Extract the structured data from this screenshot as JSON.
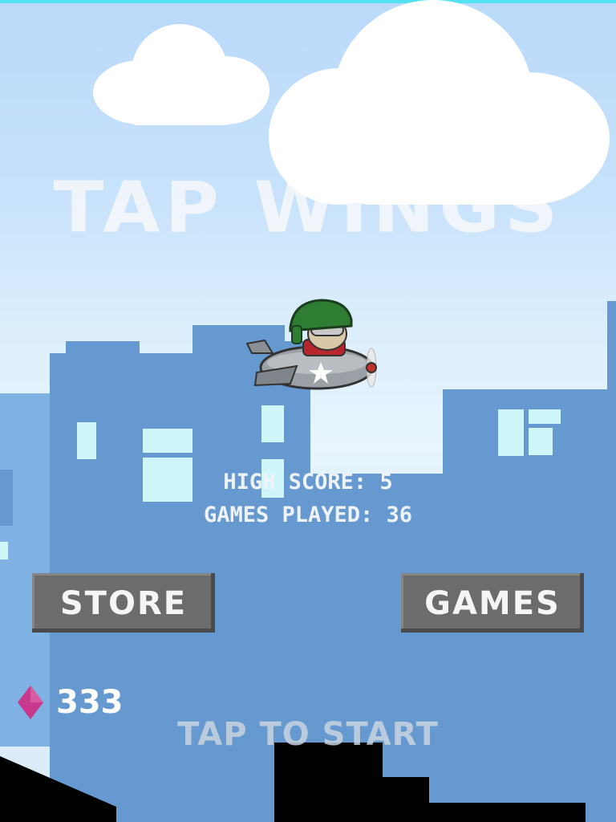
{
  "game": {
    "title": "TAP WINGS",
    "high_score_label": "HIGH SCORE: 5",
    "games_played_label": "GAMES PLAYED: 36",
    "gem_count": "333",
    "tap_to_start": "TAP TO START"
  },
  "buttons": {
    "store_label": "STORE",
    "games_label": "GAMES"
  },
  "icons": {
    "gem": "diamond-gem-icon",
    "player": "pilot-plane-icon"
  },
  "colors": {
    "sky": "#b9d9fa",
    "building": "#6599cf",
    "button": "#6c6c6c",
    "gem": "#c8388c",
    "accent_top": "#54e1f2"
  }
}
